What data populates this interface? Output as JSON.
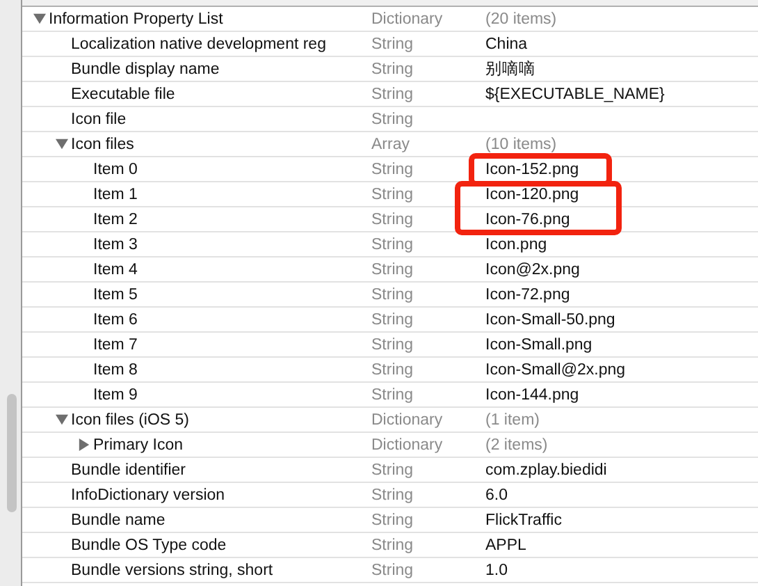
{
  "plist": [
    {
      "key": "Information Property List",
      "type": "Dictionary",
      "value": "(20 items)",
      "kind": "container",
      "expanded": true,
      "children": [
        {
          "key": "Localization native development reg",
          "type": "String",
          "value": "China",
          "kind": "leaf"
        },
        {
          "key": "Bundle display name",
          "type": "String",
          "value": "别嘀嘀",
          "kind": "leaf"
        },
        {
          "key": "Executable file",
          "type": "String",
          "value": "${EXECUTABLE_NAME}",
          "kind": "leaf"
        },
        {
          "key": "Icon file",
          "type": "String",
          "kind": "leaf"
        },
        {
          "key": "Icon files",
          "type": "Array",
          "value": "(10 items)",
          "kind": "container",
          "expanded": true,
          "children": [
            {
              "key": "Item 0",
              "type": "String",
              "value": "Icon-152.png",
              "kind": "leaf"
            },
            {
              "key": "Item 1",
              "type": "String",
              "value": "Icon-120.png",
              "kind": "leaf"
            },
            {
              "key": "Item 2",
              "type": "String",
              "value": "Icon-76.png",
              "kind": "leaf"
            },
            {
              "key": "Item 3",
              "type": "String",
              "value": "Icon.png",
              "kind": "leaf"
            },
            {
              "key": "Item 4",
              "type": "String",
              "value": "Icon@2x.png",
              "kind": "leaf"
            },
            {
              "key": "Item 5",
              "type": "String",
              "value": "Icon-72.png",
              "kind": "leaf"
            },
            {
              "key": "Item 6",
              "type": "String",
              "value": "Icon-Small-50.png",
              "kind": "leaf"
            },
            {
              "key": "Item 7",
              "type": "String",
              "value": "Icon-Small.png",
              "kind": "leaf"
            },
            {
              "key": "Item 8",
              "type": "String",
              "value": "Icon-Small@2x.png",
              "kind": "leaf"
            },
            {
              "key": "Item 9",
              "type": "String",
              "value": "Icon-144.png",
              "kind": "leaf"
            }
          ]
        },
        {
          "key": "Icon files (iOS 5)",
          "type": "Dictionary",
          "value": "(1 item)",
          "kind": "container",
          "expanded": true,
          "children": [
            {
              "key": "Primary Icon",
              "type": "Dictionary",
              "value": "(2 items)",
              "kind": "container",
              "expanded": false
            }
          ]
        },
        {
          "key": "Bundle identifier",
          "type": "String",
          "value": "com.zplay.biedidi",
          "kind": "leaf"
        },
        {
          "key": "InfoDictionary version",
          "type": "String",
          "value": "6.0",
          "kind": "leaf"
        },
        {
          "key": "Bundle name",
          "type": "String",
          "value": "FlickTraffic",
          "kind": "leaf"
        },
        {
          "key": "Bundle OS Type code",
          "type": "String",
          "value": "APPL",
          "kind": "leaf"
        },
        {
          "key": "Bundle versions string, short",
          "type": "String",
          "value": "1.0",
          "kind": "leaf"
        }
      ]
    }
  ]
}
